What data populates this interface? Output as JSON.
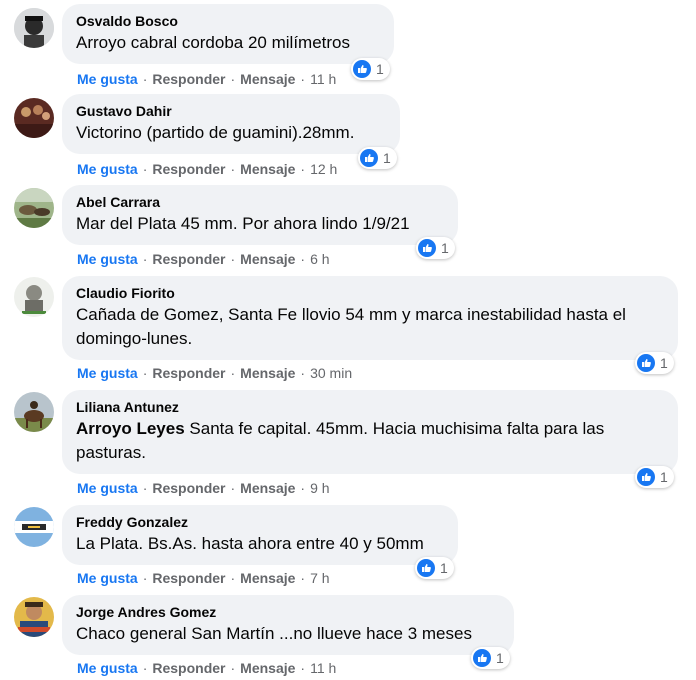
{
  "action_labels": {
    "like": "Me gusta",
    "reply": "Responder",
    "message": "Mensaje",
    "separator": "·"
  },
  "colors": {
    "accent": "#1877f2",
    "bubble": "#f0f2f5",
    "meta": "#65676b"
  },
  "comments": [
    {
      "author": "Osvaldo Bosco",
      "mention": "",
      "text": "Arroyo cabral cordoba 20 milímetros",
      "time": "11 h",
      "likes": "1"
    },
    {
      "author": "Gustavo Dahir",
      "mention": "",
      "text": "Victorino (partido de guamini).28mm.",
      "time": "12 h",
      "likes": "1"
    },
    {
      "author": "Abel Carrara",
      "mention": "",
      "text": "Mar del Plata 45 mm. Por ahora lindo 1/9/21",
      "time": "6 h",
      "likes": "1"
    },
    {
      "author": "Claudio Fiorito",
      "mention": "",
      "text": "Cañada de Gomez, Santa Fe llovio 54 mm y marca inestabilidad hasta el domingo-lunes.",
      "time": "30 min",
      "likes": "1"
    },
    {
      "author": "Liliana Antunez",
      "mention": "Arroyo Leyes",
      "text": " Santa fe capital. 45mm. Hacia muchisima falta para las pasturas.",
      "time": "9 h",
      "likes": "1"
    },
    {
      "author": "Freddy Gonzalez",
      "mention": "",
      "text": "La Plata. Bs.As. hasta ahora entre 40 y 50mm",
      "time": "7 h",
      "likes": "1"
    },
    {
      "author": "Jorge Andres Gomez",
      "mention": "",
      "text": "Chaco general San Martín ...no llueve hace 3 meses",
      "time": "11 h",
      "likes": "1"
    }
  ]
}
